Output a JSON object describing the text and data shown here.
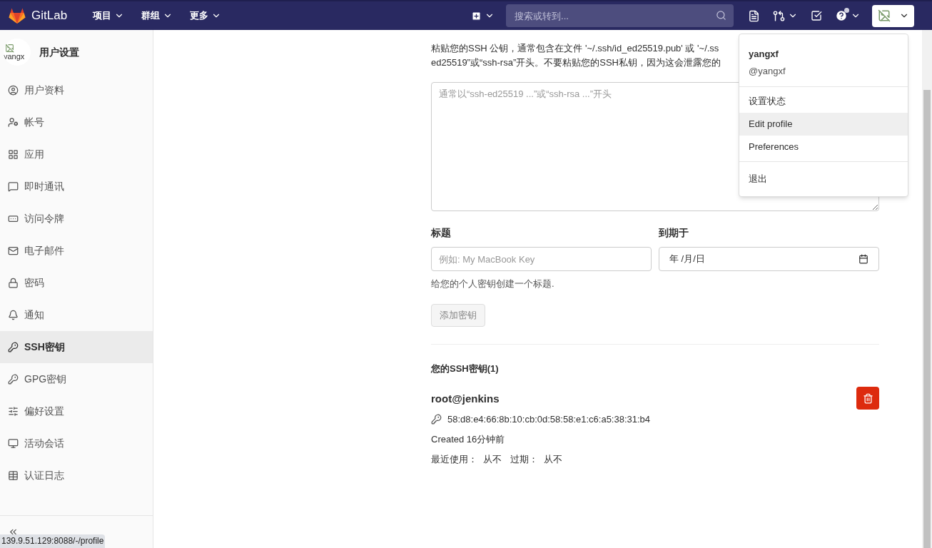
{
  "header": {
    "logo_text": "GitLab",
    "nav": [
      {
        "label": "项目"
      },
      {
        "label": "群组"
      },
      {
        "label": "更多"
      }
    ],
    "search": {
      "placeholder": "搜索或转到..."
    },
    "help_badge": true
  },
  "sidebar": {
    "avatar_alt": "yangx",
    "title": "用户设置",
    "items": [
      {
        "label": "用户资料",
        "selected": false
      },
      {
        "label": "帐号",
        "selected": false
      },
      {
        "label": "应用",
        "selected": false
      },
      {
        "label": "即时通讯",
        "selected": false
      },
      {
        "label": "访问令牌",
        "selected": false
      },
      {
        "label": "电子邮件",
        "selected": false
      },
      {
        "label": "密码",
        "selected": false
      },
      {
        "label": "通知",
        "selected": false
      },
      {
        "label": "SSH密钥",
        "selected": true
      },
      {
        "label": "GPG密钥",
        "selected": false
      },
      {
        "label": "偏好设置",
        "selected": false
      },
      {
        "label": "活动会话",
        "selected": false
      },
      {
        "label": "认证日志",
        "selected": false
      }
    ]
  },
  "form": {
    "description": [
      "粘贴您的SSH 公钥，通常包含在文件 '~/.ssh/id_ed25519.pub' 或 '~/.ss",
      "ed25519”或“ssh-rsa”开头。不要粘贴您的SSH私钥，因为这会泄露您的"
    ],
    "key_placeholder": "通常以“ssh-ed25519 ...”或“ssh-rsa ...”开头",
    "title_label": "标题",
    "title_placeholder": "例如: My MacBook Key",
    "expires_label": "到期于",
    "expires_value": "年 /月/日",
    "title_help": "给您的个人密钥创建一个标题.",
    "submit": {
      "label": "添加密钥",
      "disabled": true
    }
  },
  "keys_heading": "您的SSH密钥(1)",
  "keys": [
    {
      "title": "root@jenkins",
      "fingerprint": "58:d8:e4:66:8b:10:cb:0d:58:58:e1:c6:a5:38:31:b4",
      "created": "Created 16分钟前",
      "last_used_label": "最近使用：",
      "last_used": "从不",
      "expires_label": "过期：",
      "expires": "从不"
    }
  ],
  "user_menu": {
    "name": "yangxf",
    "username": "@yangxf",
    "items": [
      {
        "label": "设置状态",
        "selected": false,
        "divider_before": false
      },
      {
        "label": "Edit profile",
        "selected": true,
        "divider_before": false
      },
      {
        "label": "Preferences",
        "selected": false,
        "divider_before": false
      },
      {
        "label": "退出",
        "selected": false,
        "divider_before": true
      }
    ]
  },
  "status_url": "139.9.51.129:8088/-/profile"
}
